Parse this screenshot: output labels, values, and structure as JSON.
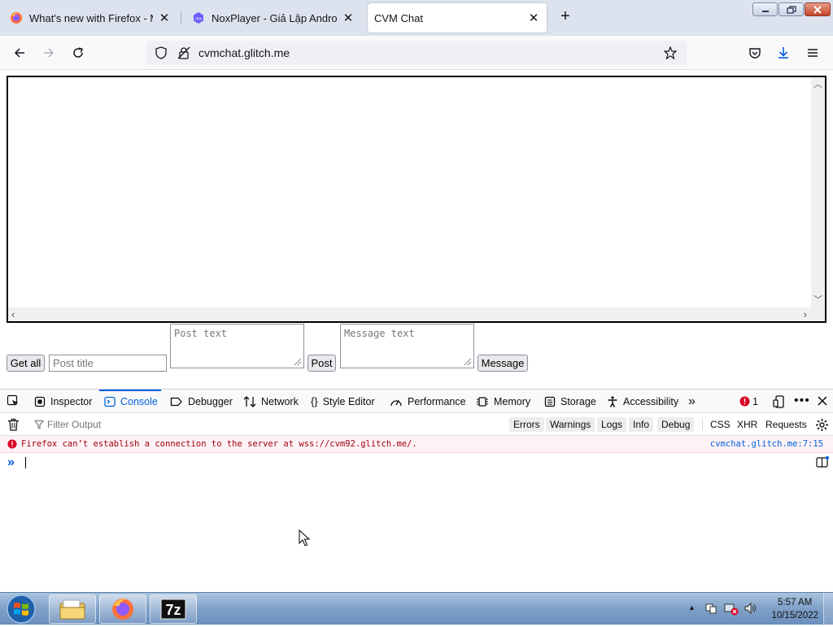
{
  "browser": {
    "tabs": [
      {
        "title": "What's new with Firefox - More",
        "icon": "firefox-icon"
      },
      {
        "title": "NoxPlayer - Giả Lập Android Nh",
        "icon": "noxplayer-icon"
      },
      {
        "title": "CVM Chat",
        "icon": "none",
        "selected": true
      }
    ],
    "url": "cvmchat.glitch.me"
  },
  "page": {
    "get_all_label": "Get all",
    "post_title_placeholder": "Post title",
    "post_text_placeholder": "Post text",
    "post_label": "Post",
    "message_text_placeholder": "Message text",
    "message_label": "Message"
  },
  "devtools": {
    "tabs": [
      {
        "label": "Inspector",
        "icon": "inspector-icon"
      },
      {
        "label": "Console",
        "icon": "console-icon",
        "active": true
      },
      {
        "label": "Debugger",
        "icon": "debugger-icon"
      },
      {
        "label": "Network",
        "icon": "network-icon"
      },
      {
        "label": "Style Editor",
        "icon": "style-editor-icon"
      },
      {
        "label": "Performance",
        "icon": "performance-icon"
      },
      {
        "label": "Memory",
        "icon": "memory-icon"
      },
      {
        "label": "Storage",
        "icon": "storage-icon"
      },
      {
        "label": "Accessibility",
        "icon": "accessibility-icon"
      }
    ],
    "error_count": "1",
    "filter_placeholder": "Filter Output",
    "levels": [
      "Errors",
      "Warnings",
      "Logs",
      "Info",
      "Debug"
    ],
    "extra_filters": [
      "CSS",
      "XHR",
      "Requests"
    ],
    "messages": [
      {
        "level": "error",
        "text": "Firefox can’t establish a connection to the server at wss://cvm92.glitch.me/.",
        "source": "cvmchat.glitch.me:7:15"
      }
    ]
  },
  "taskbar": {
    "apps": [
      "windows-explorer-icon",
      "firefox-icon",
      "7zip-icon"
    ],
    "time": "5:57 AM",
    "date": "10/15/2022"
  },
  "colors": {
    "accent": "#0060df",
    "error_text": "#a4000f",
    "error_bg": "#fdf2f5"
  }
}
